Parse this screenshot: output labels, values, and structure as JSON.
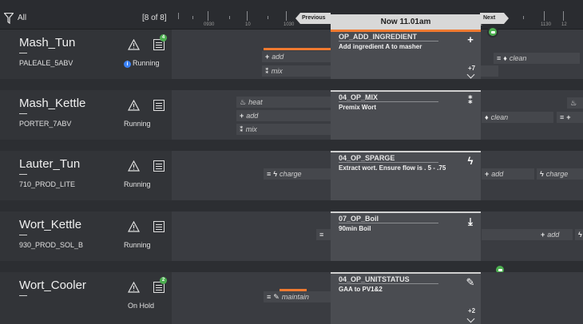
{
  "filter": {
    "label": "All",
    "count": "[8 of 8]"
  },
  "timeline": {
    "ticks": [
      "0930",
      "10",
      "1030",
      "11",
      "1130",
      "12"
    ],
    "previous_label": "Previous",
    "next_label": "Next",
    "now_label": "Now 11.01am"
  },
  "units": [
    {
      "name": "Mash_Tun",
      "recipe": "PALEALE_5ABV",
      "state": "Running",
      "badge": "4",
      "chips": [
        "add",
        "mix",
        "clean"
      ],
      "op": {
        "code": "OP_ADD_INGREDIENT",
        "desc": "Add ingredient A to masher",
        "icon": "plus-icon",
        "more": "+7"
      }
    },
    {
      "name": "Mash_Kettle",
      "recipe": "PORTER_7ABV",
      "state": "Running",
      "chips": [
        "heat",
        "add",
        "mix",
        "clean"
      ],
      "op": {
        "code": "04_OP_MIX",
        "desc": "Premix Wort",
        "icon": "mix-icon"
      }
    },
    {
      "name": "Lauter_Tun",
      "recipe": "710_PROD_LITE",
      "state": "Running",
      "chips": [
        "charge",
        "add",
        "charge"
      ],
      "op": {
        "code": "04_OP_SPARGE",
        "desc": "Extract wort. Ensure flow is . 5 - .75",
        "icon": "bolt-icon"
      }
    },
    {
      "name": "Wort_Kettle",
      "recipe": "930_PROD_SOL_B",
      "state": "Running",
      "chips": [
        "add"
      ],
      "op": {
        "code": "07_OP_Boil",
        "desc": "90min Boil",
        "icon": "download-icon"
      }
    },
    {
      "name": "Wort_Cooler",
      "recipe": "",
      "state": "On Hold",
      "badge": "2",
      "chips": [
        "maintain"
      ],
      "op": {
        "code": "04_OP_UNITSTATUS",
        "desc": "GAA to PV1&2",
        "icon": "wrench-icon",
        "more": "+2"
      }
    }
  ],
  "colors": {
    "accent": "#f07a30",
    "badge": "#4caf50",
    "info": "#3b82f6"
  }
}
